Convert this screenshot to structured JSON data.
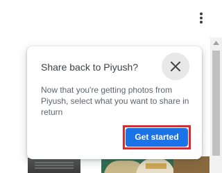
{
  "page": {
    "menu_icon": "more-vert-icon"
  },
  "dialog": {
    "title": "Share back to Piyush?",
    "body": "Now that you're getting photos from Piyush, select what you want to share in return",
    "close_icon": "close-icon",
    "cta_label": "Get started"
  },
  "colors": {
    "primary_button": "#1a73e8",
    "highlight_outline": "#e3262e",
    "title_text": "#3c4043",
    "body_text": "#5f6368"
  }
}
